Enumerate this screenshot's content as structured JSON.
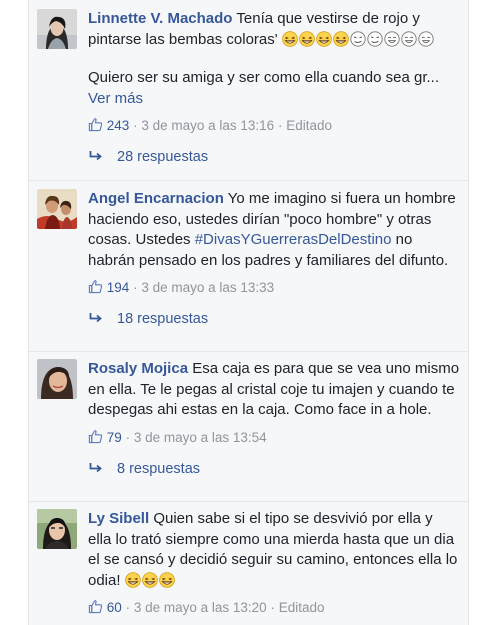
{
  "comments": [
    {
      "author": "Linnette V. Machado",
      "text": "Tenía que vestirse de rojo y pintarse las bembas coloras'",
      "emoji_icons": [
        "grinning-squint-icon",
        "grinning-squint-icon",
        "grinning-squint-icon",
        "grinning-squint-icon",
        "smirk-face-icon",
        "smirk-face-icon",
        "laughing-face-icon",
        "laughing-face-icon",
        "laughing-face-icon"
      ],
      "text2": "Quiero ser su amiga y ser como ella cuando sea gr...",
      "see_more": "Ver más",
      "likes": "243",
      "sep": "·",
      "timestamp": "3 de mayo a las 13:16",
      "edited": "Editado",
      "replies": "28 respuestas"
    },
    {
      "author": "Angel Encarnacion",
      "text_before": "Yo me imagino si fuera un hombre haciendo eso, ustedes dirían \"poco hombre\" y otras cosas. Ustedes",
      "hashtag": "#DivasYGuerrerasDelDestino",
      "text_after": "no habrán pensado en los padres y familiares del difunto.",
      "likes": "194",
      "sep": "·",
      "timestamp": "3 de mayo a las 13:33",
      "replies": "18 respuestas"
    },
    {
      "author": "Rosaly Mojica",
      "text": "Esa caja es para que se vea uno mismo en ella. Te le pegas al cristal coje tu imajen y cuando te despegas ahi estas en la caja. Como face in a hole.",
      "likes": "79",
      "sep": "·",
      "timestamp": "3 de mayo a las 13:54",
      "replies": "8 respuestas"
    },
    {
      "author": "Ly Sibell",
      "text": "Quien sabe si el tipo se desvivió por ella y ella lo trató siempre como una mierda hasta que un dia el se cansó y decidió seguir su camino, entonces ella lo odia!",
      "emoji_icons": [
        "grinning-squint-icon",
        "grinning-squint-icon",
        "grinning-squint-icon"
      ],
      "likes": "60",
      "sep": "·",
      "timestamp": "3 de mayo a las 13:20",
      "edited": "Editado"
    }
  ],
  "colors": {
    "link": "#365899",
    "meta": "#90949c",
    "text": "#1d2129",
    "background": "#f6f7f9"
  }
}
